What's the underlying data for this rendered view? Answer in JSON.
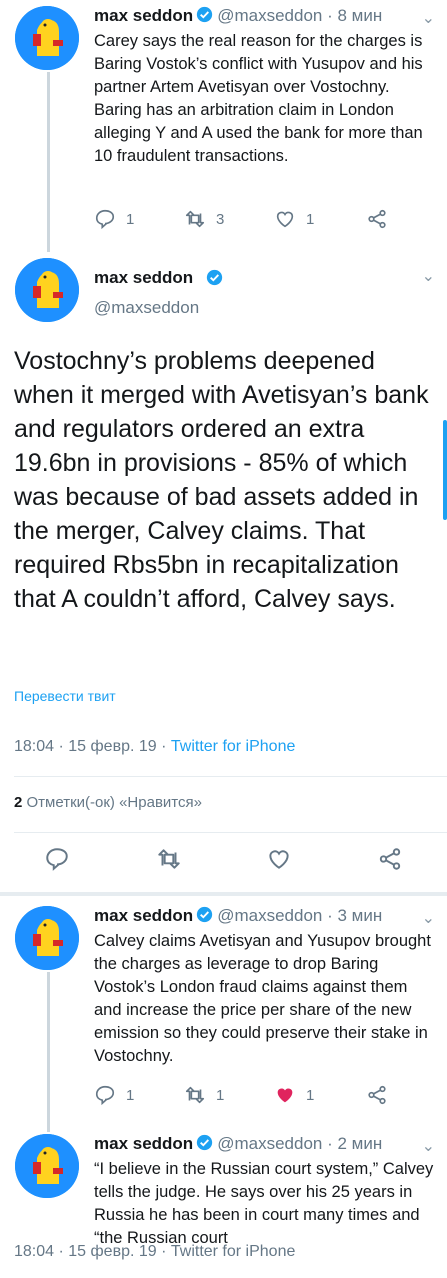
{
  "tweets": [
    {
      "name": "max seddon",
      "handle": "@maxseddon",
      "time": "· 8 мин",
      "text": "Carey says the real reason for the charges is Baring Vostok’s conflict with Yusupov and his partner Artem Avetisyan over Vostochny. Baring has an arbitration claim in London alleging Y and A used the bank for more than 10 fraudulent transactions.",
      "replies": "1",
      "retweets": "3",
      "likes": "1"
    },
    {
      "name": "max seddon",
      "handle": "@maxseddon",
      "text": "Vostochny’s problems deepened when it merged with Avetisyan’s bank and regulators ordered an extra 19.6bn in provisions - 85% of which was because of bad assets added in the merger, Calvey claims. That required Rbs5bn in recapitalization that A couldn’t afford, Calvey says.",
      "translate": "Перевести твит",
      "timestamp": "18:04 · 15 февр. 19 ·",
      "source": "Twitter for iPhone",
      "like_count": "2",
      "like_label": "Отметки(-ок) «Нравится»"
    },
    {
      "name": "max seddon",
      "handle": "@maxseddon",
      "time": "· 3 мин",
      "text": "Calvey claims Avetisyan and Yusupov brought the charges as leverage to drop Baring Vostok’s London fraud claims against them and increase the price per share of the new emission so they could preserve their stake in Vostochny.",
      "replies": "1",
      "retweets": "1",
      "likes": "1"
    },
    {
      "name": "max seddon",
      "handle": "@maxseddon",
      "time": "· 2 мин",
      "text": "“I believe in the Russian court system,” Calvey tells the judge. He says over his 25 years in Russia he has been in court many times and “the Russian court",
      "overlay": "18:04 · 15 февр. 19 · Twitter for iPhone"
    }
  ],
  "icons": [
    "chevron-down-icon",
    "verified-icon",
    "reply-icon",
    "retweet-icon",
    "like-icon",
    "share-icon"
  ],
  "colors": {
    "accent": "#1da1f2",
    "muted": "#657786",
    "like_active": "#e0245e"
  }
}
